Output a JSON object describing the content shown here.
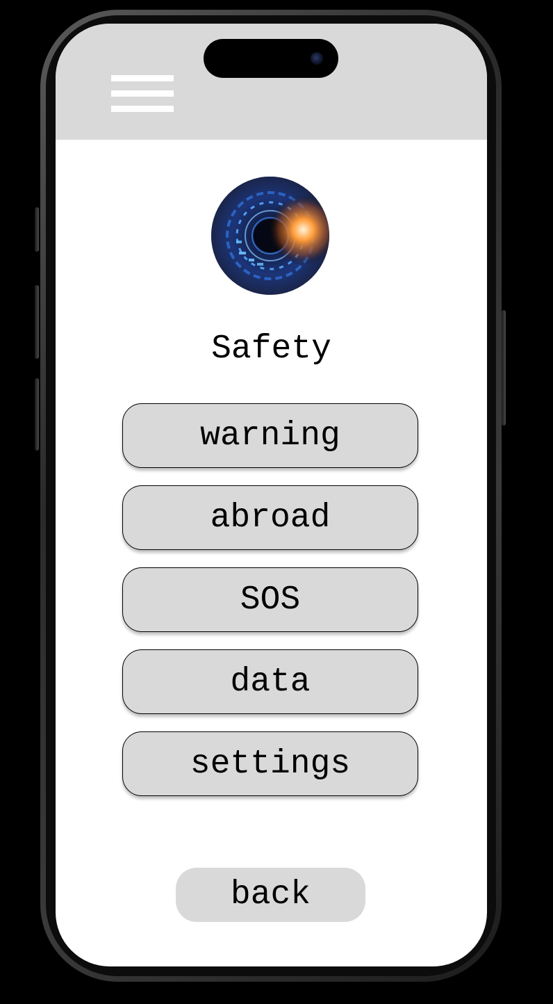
{
  "app": {
    "title": "Safety"
  },
  "header": {
    "menu_icon": "hamburger-menu-icon"
  },
  "avatar": {
    "icon": "cyber-eye-image"
  },
  "menu": {
    "items": [
      {
        "label": "warning"
      },
      {
        "label": "abroad"
      },
      {
        "label": "SOS"
      },
      {
        "label": "data"
      },
      {
        "label": "settings"
      }
    ]
  },
  "footer": {
    "back_label": "back"
  },
  "colors": {
    "header_bg": "#d9d9d9",
    "button_bg": "#d9d9d9",
    "screen_bg": "#ffffff",
    "text": "#000000"
  }
}
